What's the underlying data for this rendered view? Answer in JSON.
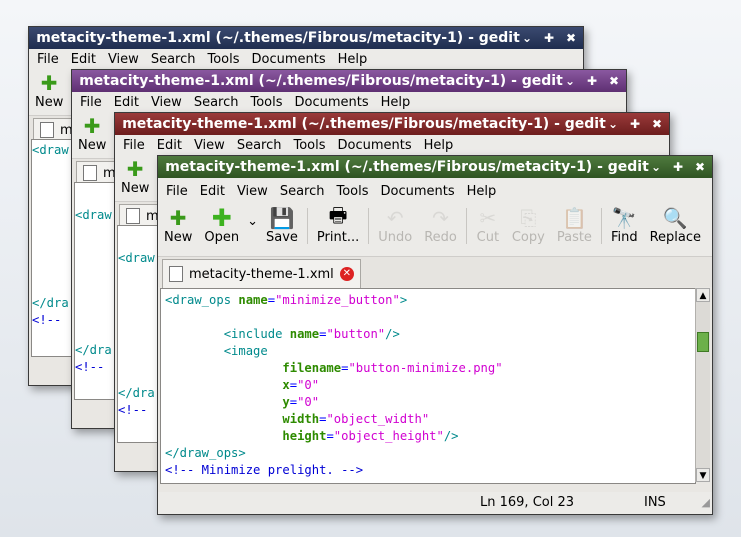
{
  "window_title": "metacity-theme-1.xml (~/.themes/Fibrous/metacity-1) - gedit",
  "menu": [
    "File",
    "Edit",
    "View",
    "Search",
    "Tools",
    "Documents",
    "Help"
  ],
  "toolbar": {
    "new": "New",
    "open": "Open",
    "save": "Save",
    "print": "Print...",
    "undo": "Undo",
    "redo": "Redo",
    "cut": "Cut",
    "copy": "Copy",
    "paste": "Paste",
    "find": "Find",
    "replace": "Replace"
  },
  "tab_label": "metacity-theme-1.xml",
  "tab_label_short": "me",
  "bg_snippets": {
    "draw_open": "<draw",
    "draw_close": "</dra",
    "comment_open": "<!--"
  },
  "code": [
    {
      "t": "<draw_ops",
      "a": " name",
      "e": "=",
      "v": "\"minimize_button\"",
      "c": ">"
    },
    {
      "blank": true
    },
    {
      "indent": "        ",
      "t": "<include",
      "a": " name",
      "e": "=",
      "v": "\"button\"",
      "c": "/>"
    },
    {
      "indent": "        ",
      "t": "<image"
    },
    {
      "indent": "                ",
      "a": "filename",
      "e": "=",
      "v": "\"button-minimize.png\""
    },
    {
      "indent": "                ",
      "a": "x",
      "e": "=",
      "v": "\"0\""
    },
    {
      "indent": "                ",
      "a": "y",
      "e": "=",
      "v": "\"0\""
    },
    {
      "indent": "                ",
      "a": "width",
      "e": "=",
      "v": "\"object_width\""
    },
    {
      "indent": "                ",
      "a": "height",
      "e": "=",
      "v": "\"object_height\"",
      "c": "/>"
    },
    {
      "t": "</draw_ops>"
    },
    {
      "comment": "<!-- Minimize prelight. -->"
    }
  ],
  "status": {
    "position": "Ln 169, Col 23",
    "mode": "INS"
  },
  "colors": {
    "navy": "#1f2d4f",
    "purple": "#5e2f72",
    "maroon": "#6d1d1d",
    "green": "#2f5422"
  }
}
